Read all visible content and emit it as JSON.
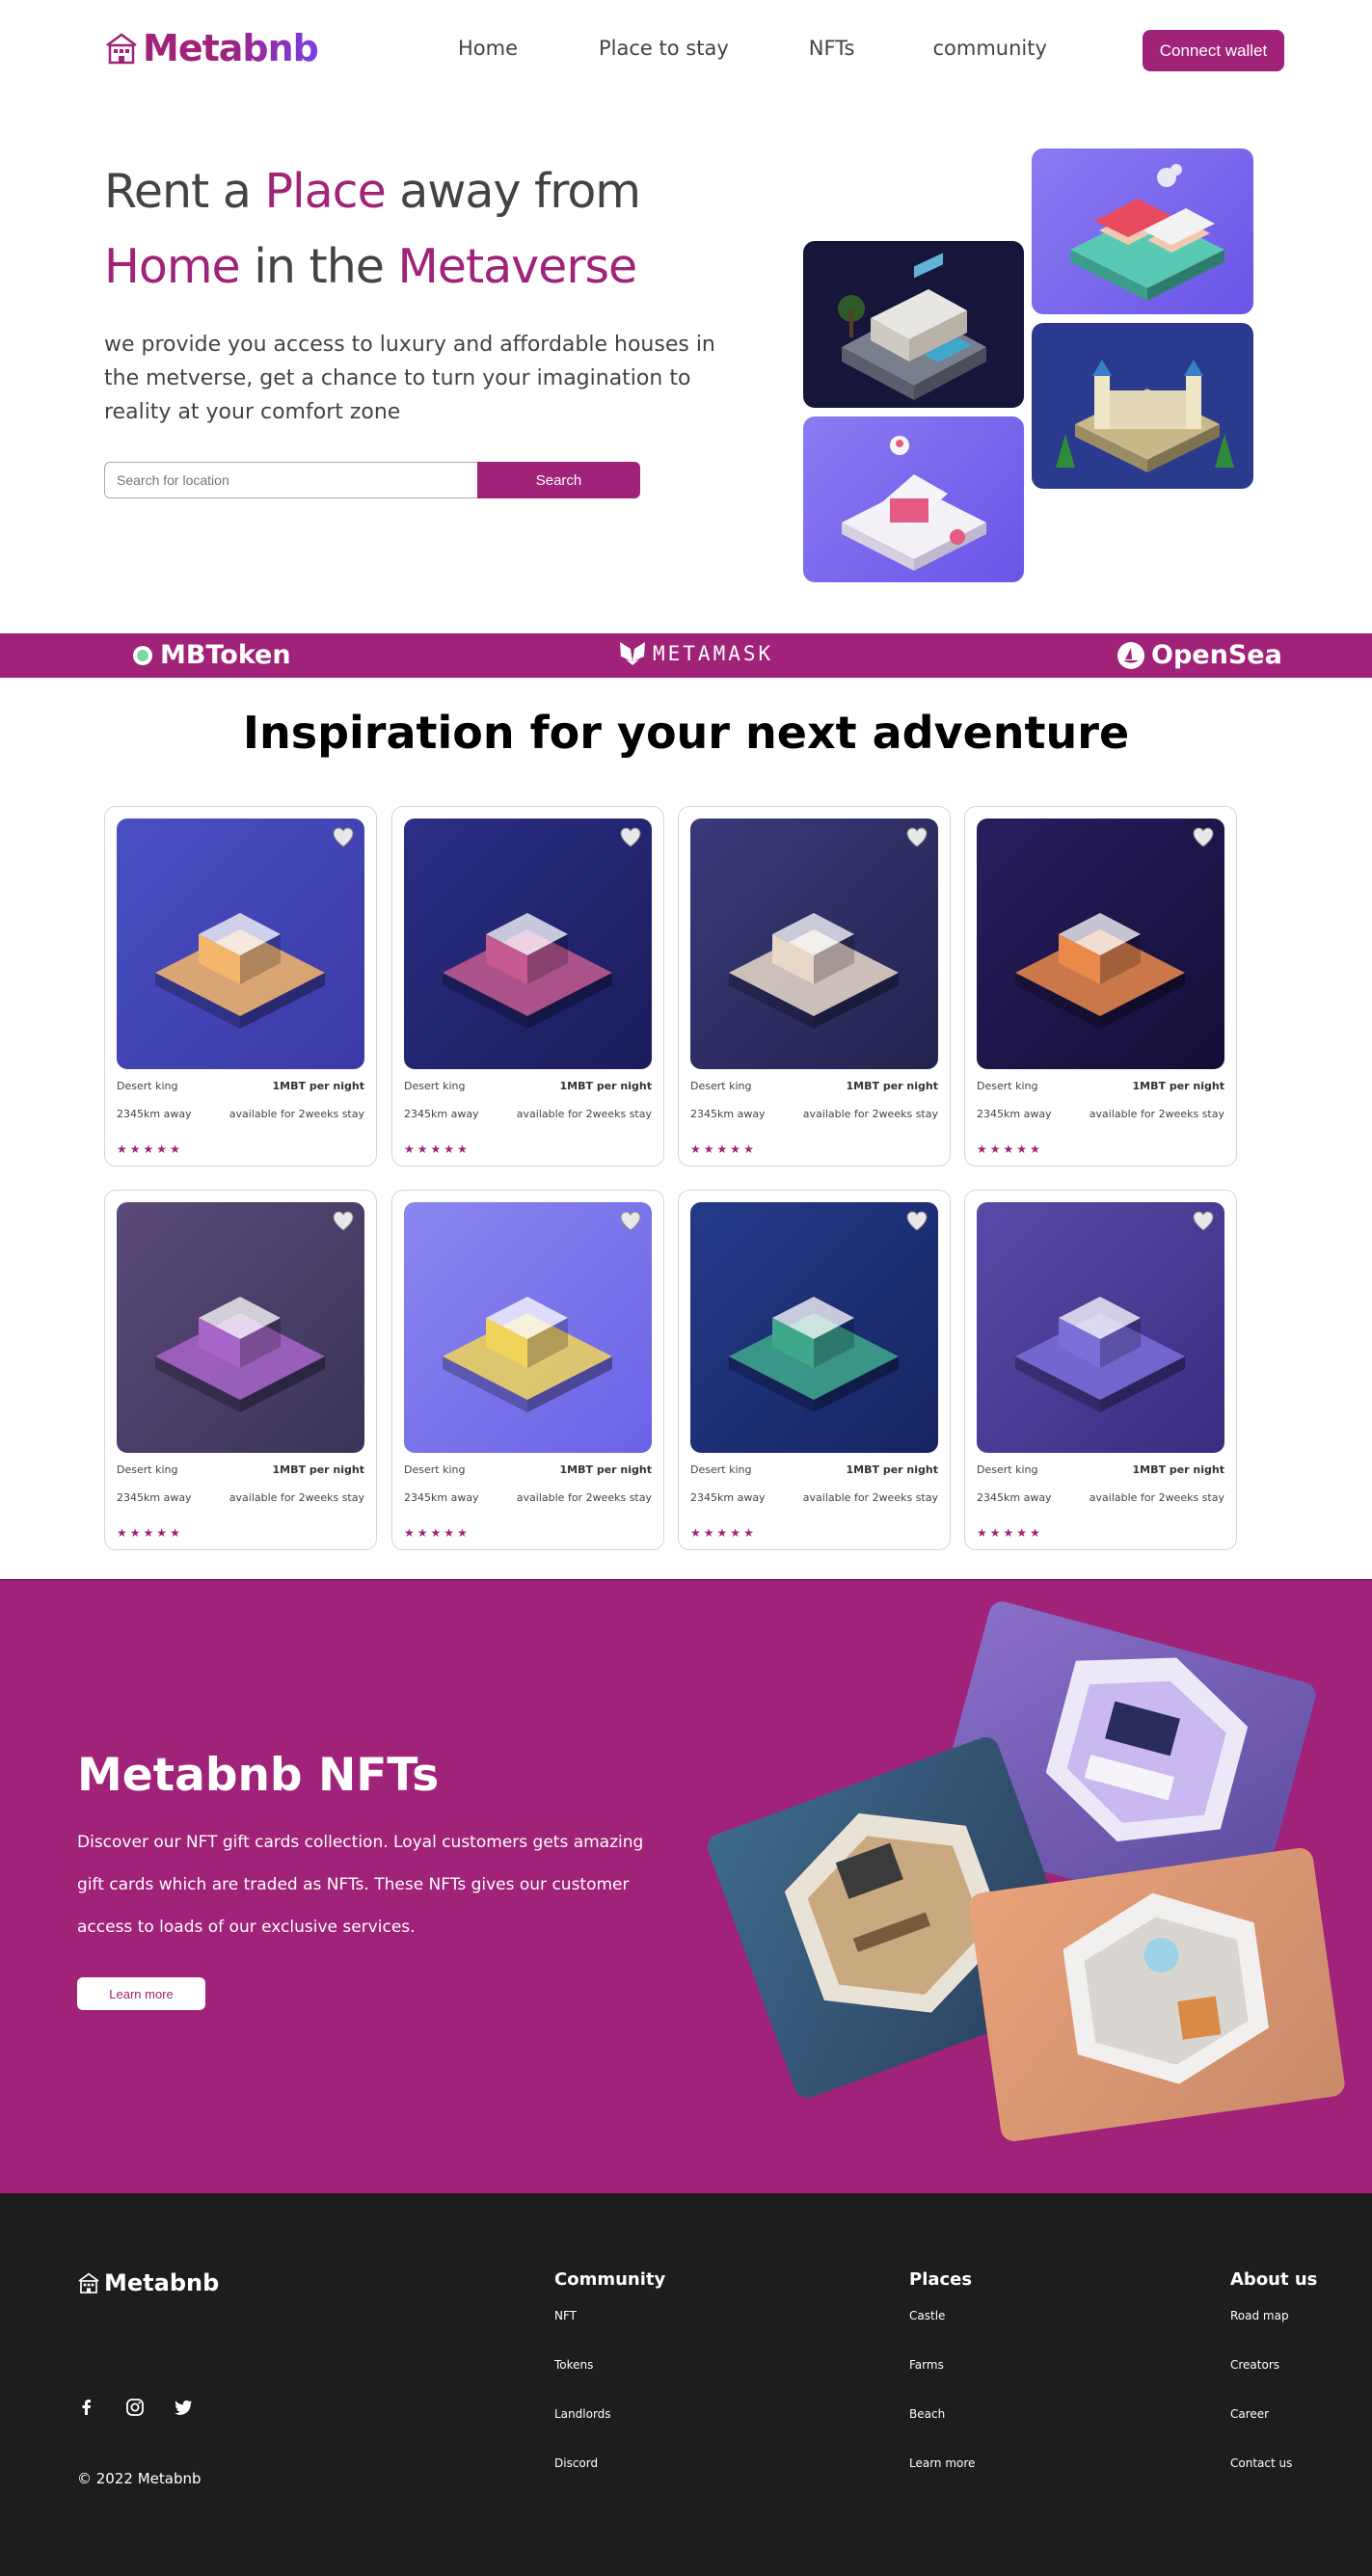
{
  "nav": {
    "logo": "Metabnb",
    "links": [
      "Home",
      "Place to stay",
      "NFTs",
      "community"
    ],
    "connect_wallet": "Connect wallet"
  },
  "hero": {
    "title_part1": "Rent a ",
    "title_accent1": "Place",
    "title_part2": " away from",
    "title_accent2": "Home",
    "title_part3": " in the ",
    "title_accent3": "Metaverse",
    "description": "we provide you access to luxury and affordable houses in the metverse, get a chance to turn your imagination to reality at your comfort zone",
    "search_placeholder": "Search for location",
    "search_button": "Search"
  },
  "partners": [
    "MBToken",
    "METAMASK",
    "OpenSea"
  ],
  "inspiration": {
    "title": "Inspiration for your next adventure",
    "cards": [
      {
        "name": "Desert king",
        "price": "1MBT per night",
        "distance": "2345km away",
        "availability": "available for 2weeks stay",
        "rating": 5
      },
      {
        "name": "Desert king",
        "price": "1MBT per night",
        "distance": "2345km away",
        "availability": "available for 2weeks stay",
        "rating": 5
      },
      {
        "name": "Desert king",
        "price": "1MBT per night",
        "distance": "2345km away",
        "availability": "available for 2weeks stay",
        "rating": 5
      },
      {
        "name": "Desert king",
        "price": "1MBT per night",
        "distance": "2345km away",
        "availability": "available for 2weeks stay",
        "rating": 5
      },
      {
        "name": "Desert king",
        "price": "1MBT per night",
        "distance": "2345km away",
        "availability": "available for 2weeks stay",
        "rating": 5
      },
      {
        "name": "Desert king",
        "price": "1MBT per night",
        "distance": "2345km away",
        "availability": "available for 2weeks stay",
        "rating": 5
      },
      {
        "name": "Desert king",
        "price": "1MBT per night",
        "distance": "2345km away",
        "availability": "available for 2weeks stay",
        "rating": 5
      },
      {
        "name": "Desert king",
        "price": "1MBT per night",
        "distance": "2345km away",
        "availability": "available for 2weeks stay",
        "rating": 5
      }
    ]
  },
  "nft": {
    "title": "Metabnb NFTs",
    "description": "Discover our NFT gift cards collection. Loyal customers gets amazing gift cards which are traded as NFTs. These NFTs gives our customer access to loads of our exclusive services.",
    "button": "Learn more"
  },
  "footer": {
    "logo": "Metabnb",
    "copyright": "© 2022 Metabnb",
    "columns": [
      {
        "title": "Community",
        "links": [
          "NFT",
          "Tokens",
          "Landlords",
          "Discord"
        ]
      },
      {
        "title": "Places",
        "links": [
          "Castle",
          "Farms",
          "Beach",
          "Learn more"
        ]
      },
      {
        "title": "About us",
        "links": [
          "Road map",
          "Creators",
          "Career",
          "Contact us"
        ]
      }
    ]
  },
  "colors": {
    "brand": "#a02279",
    "footer_bg": "#1d1d1d",
    "text": "#434343"
  }
}
